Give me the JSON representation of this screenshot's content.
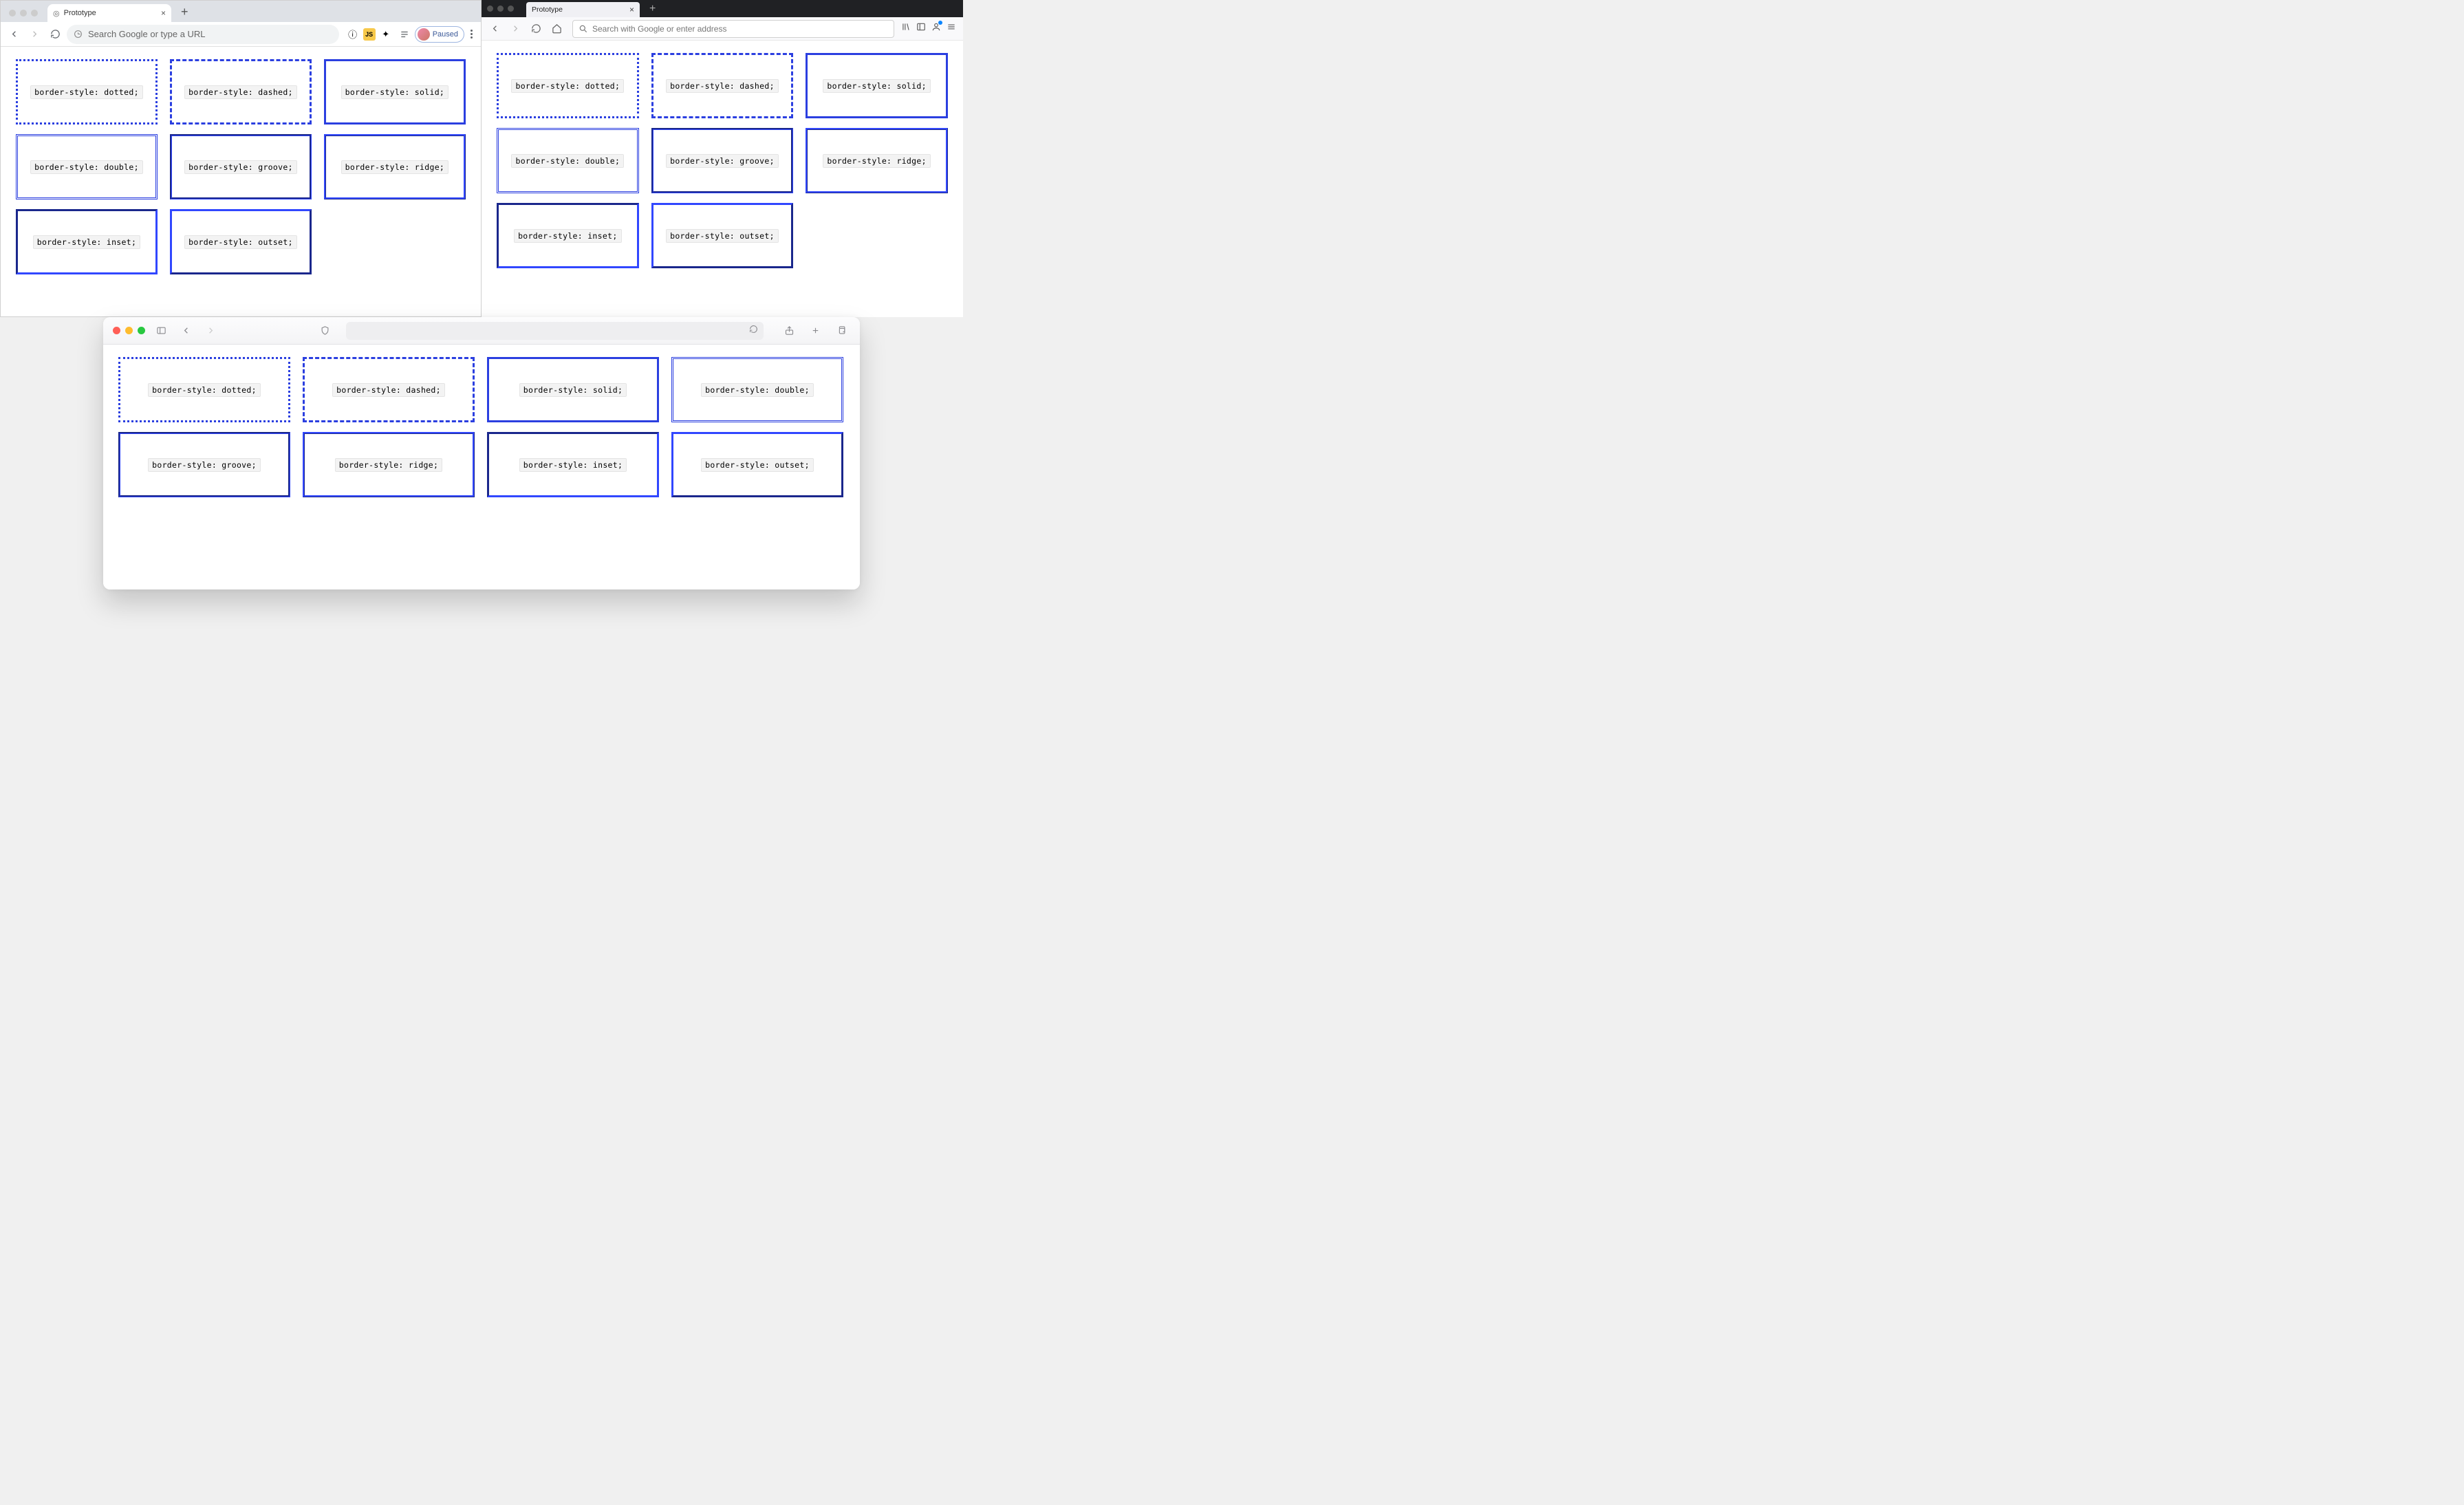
{
  "colors": {
    "border": "#2b3fe0"
  },
  "chrome": {
    "tab_title": "Prototype",
    "omnibox_placeholder": "Search Google or type a URL",
    "profile_label": "Paused",
    "items": [
      {
        "label": "border-style: dotted;",
        "style_class": "style-dotted"
      },
      {
        "label": "border-style: dashed;",
        "style_class": "style-dashed"
      },
      {
        "label": "border-style: solid;",
        "style_class": "style-solid"
      },
      {
        "label": "border-style: double;",
        "style_class": "style-double"
      },
      {
        "label": "border-style: groove;",
        "style_class": "style-groove"
      },
      {
        "label": "border-style: ridge;",
        "style_class": "style-ridge"
      },
      {
        "label": "border-style: inset;",
        "style_class": "style-inset"
      },
      {
        "label": "border-style: outset;",
        "style_class": "style-outset"
      }
    ]
  },
  "firefox": {
    "tab_title": "Prototype",
    "omnibox_placeholder": "Search with Google or enter address",
    "items": [
      {
        "label": "border-style: dotted;",
        "style_class": "style-dotted"
      },
      {
        "label": "border-style: dashed;",
        "style_class": "style-dashed"
      },
      {
        "label": "border-style: solid;",
        "style_class": "style-solid"
      },
      {
        "label": "border-style: double;",
        "style_class": "style-double"
      },
      {
        "label": "border-style: groove;",
        "style_class": "style-groove"
      },
      {
        "label": "border-style: ridge;",
        "style_class": "style-ridge"
      },
      {
        "label": "border-style: inset;",
        "style_class": "style-inset"
      },
      {
        "label": "border-style: outset;",
        "style_class": "style-outset"
      }
    ]
  },
  "safari": {
    "items": [
      {
        "label": "border-style: dotted;",
        "style_class": "style-dotted"
      },
      {
        "label": "border-style: dashed;",
        "style_class": "style-dashed"
      },
      {
        "label": "border-style: solid;",
        "style_class": "style-solid"
      },
      {
        "label": "border-style: double;",
        "style_class": "style-double"
      },
      {
        "label": "border-style: groove;",
        "style_class": "style-groove"
      },
      {
        "label": "border-style: ridge;",
        "style_class": "style-ridge"
      },
      {
        "label": "border-style: inset;",
        "style_class": "style-inset"
      },
      {
        "label": "border-style: outset;",
        "style_class": "style-outset"
      }
    ]
  }
}
